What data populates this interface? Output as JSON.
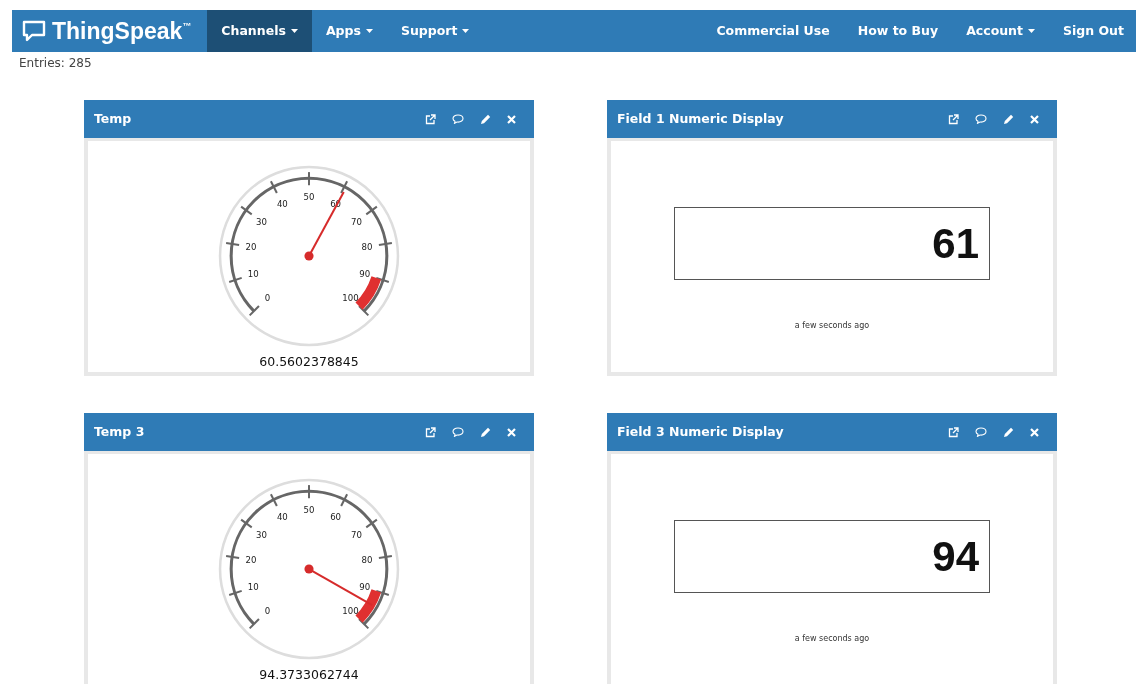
{
  "navbar": {
    "brand": "ThingSpeak$^{™}$",
    "left_items": [
      {
        "label": "Channels",
        "dropdown": true,
        "selected": true
      },
      {
        "label": "Apps",
        "dropdown": true,
        "selected": false
      },
      {
        "label": "Support",
        "dropdown": true,
        "selected": false
      }
    ],
    "right_items": [
      {
        "label": "Commercial Use",
        "dropdown": false,
        "selected": false
      },
      {
        "label": "How to Buy",
        "dropdown": false,
        "selected": false
      },
      {
        "label": "Account",
        "dropdown": true,
        "selected": false
      },
      {
        "label": "Sign Out",
        "dropdown": false,
        "selected": false
      }
    ]
  },
  "entries": "Entries: 285",
  "widgets": [
    {
      "kind": "gauge",
      "title": "Temp",
      "scale": [
        "0",
        "10",
        "20",
        "30",
        "40",
        "50",
        "60",
        "70",
        "80",
        "90",
        "100"
      ],
      "value": "60.5602378845"
    },
    {
      "kind": "numeric",
      "title": "Field 1 Numeric Display",
      "value": "61",
      "time": "a few seconds ago"
    },
    {
      "kind": "gauge",
      "title": "Temp 3",
      "scale": [
        "0",
        "10",
        "20",
        "30",
        "40",
        "50",
        "60",
        "70",
        "80",
        "90",
        "100"
      ],
      "value": "94.3733062744"
    },
    {
      "kind": "numeric",
      "title": "Field 3 Numeric Display",
      "value": "94",
      "time": "a few seconds ago"
    }
  ]
}
